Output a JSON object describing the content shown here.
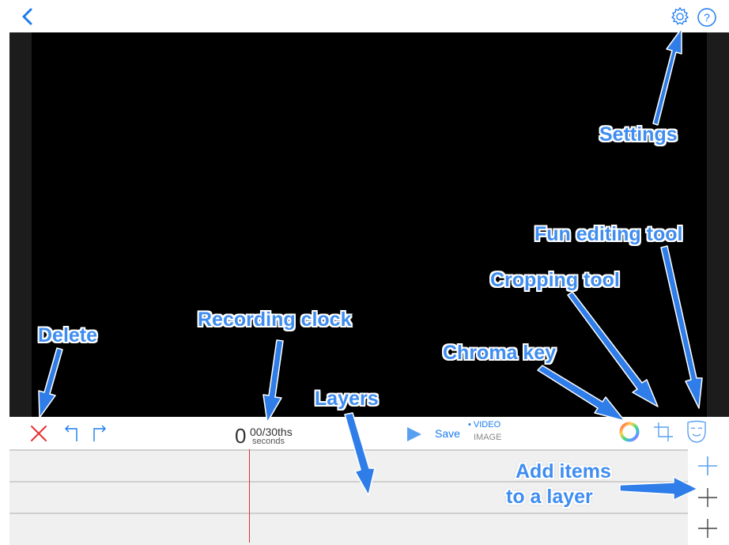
{
  "header": {
    "back_icon": "chevron-left-icon",
    "settings_icon": "gear-icon",
    "help_label": "?"
  },
  "toolbar": {
    "delete_icon": "close-icon",
    "undo_icon": "undo-icon",
    "redo_icon": "redo-icon",
    "clock_value": "0",
    "clock_fraction": "00/30ths",
    "clock_unit": "seconds",
    "play_icon": "play-icon",
    "save_label": "Save",
    "save_option_video": "• VIDEO",
    "save_option_image": "IMAGE",
    "chroma_icon": "color-wheel-icon",
    "crop_icon": "crop-icon",
    "mask_icon": "mask-icon"
  },
  "layers": {
    "count": 3,
    "add_icon": "plus-icon"
  },
  "annotations": {
    "settings": "Settings",
    "fun_editing": "Fun editing tool",
    "cropping": "Cropping tool",
    "recording_clock": "Recording clock",
    "delete": "Delete",
    "chroma_key": "Chroma key",
    "layers": "Layers",
    "add_items_line1": "Add items",
    "add_items_line2": "to a layer"
  },
  "colors": {
    "accent": "#1a7cf0",
    "annotation": "#3f8df0",
    "delete": "#e83030",
    "playhead": "#e03030",
    "preview_bg": "#000000"
  }
}
